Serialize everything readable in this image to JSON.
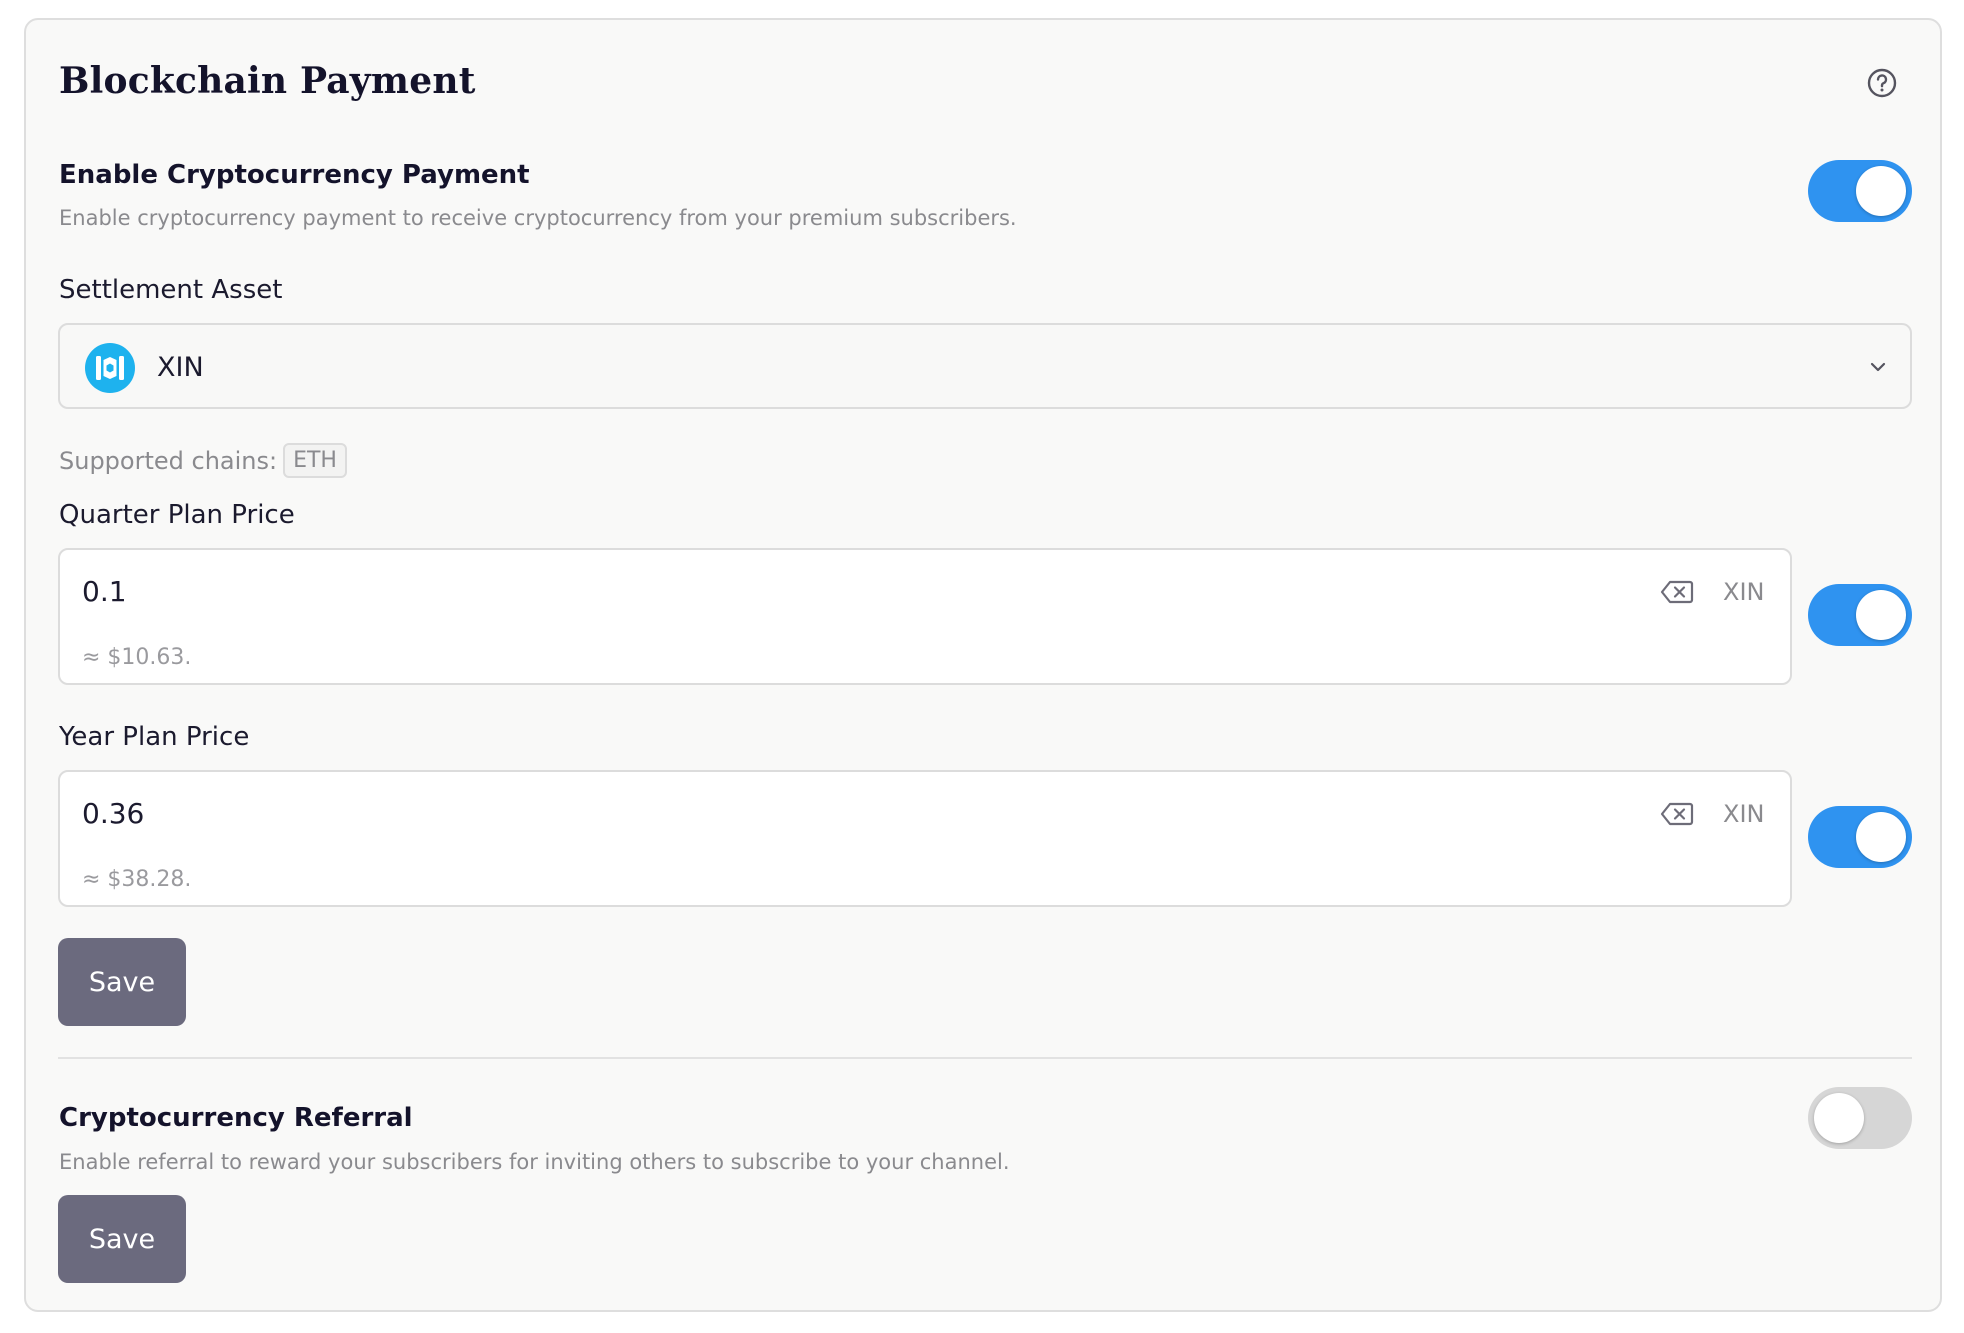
{
  "card": {
    "title": "Blockchain Payment",
    "help_icon": "question-circle-icon"
  },
  "enable_crypto": {
    "title": "Enable Cryptocurrency Payment",
    "description": "Enable cryptocurrency payment to receive cryptocurrency from your premium subscribers.",
    "enabled": true
  },
  "settlement": {
    "label": "Settlement Asset",
    "selected_asset": "XIN",
    "asset_icon": "mixin-logo-icon",
    "supported_chains_label": "Supported chains:",
    "chains": [
      "ETH"
    ]
  },
  "quarter_plan": {
    "label": "Quarter Plan Price",
    "value": "0.1",
    "unit": "XIN",
    "approx": "≈  $10.63.",
    "enabled": true
  },
  "year_plan": {
    "label": "Year Plan Price",
    "value": "0.36",
    "unit": "XIN",
    "approx": "≈  $38.28.",
    "enabled": true
  },
  "save_label": "Save",
  "referral": {
    "title": "Cryptocurrency Referral",
    "description": "Enable referral to reward your subscribers for inviting others to subscribe to your channel.",
    "enabled": false,
    "save_label": "Save"
  },
  "colors": {
    "toggle_on": "#2f93f0",
    "toggle_off": "#d6d6d6",
    "button": "#6b6a7e",
    "asset_logo": "#1eb2ee"
  }
}
